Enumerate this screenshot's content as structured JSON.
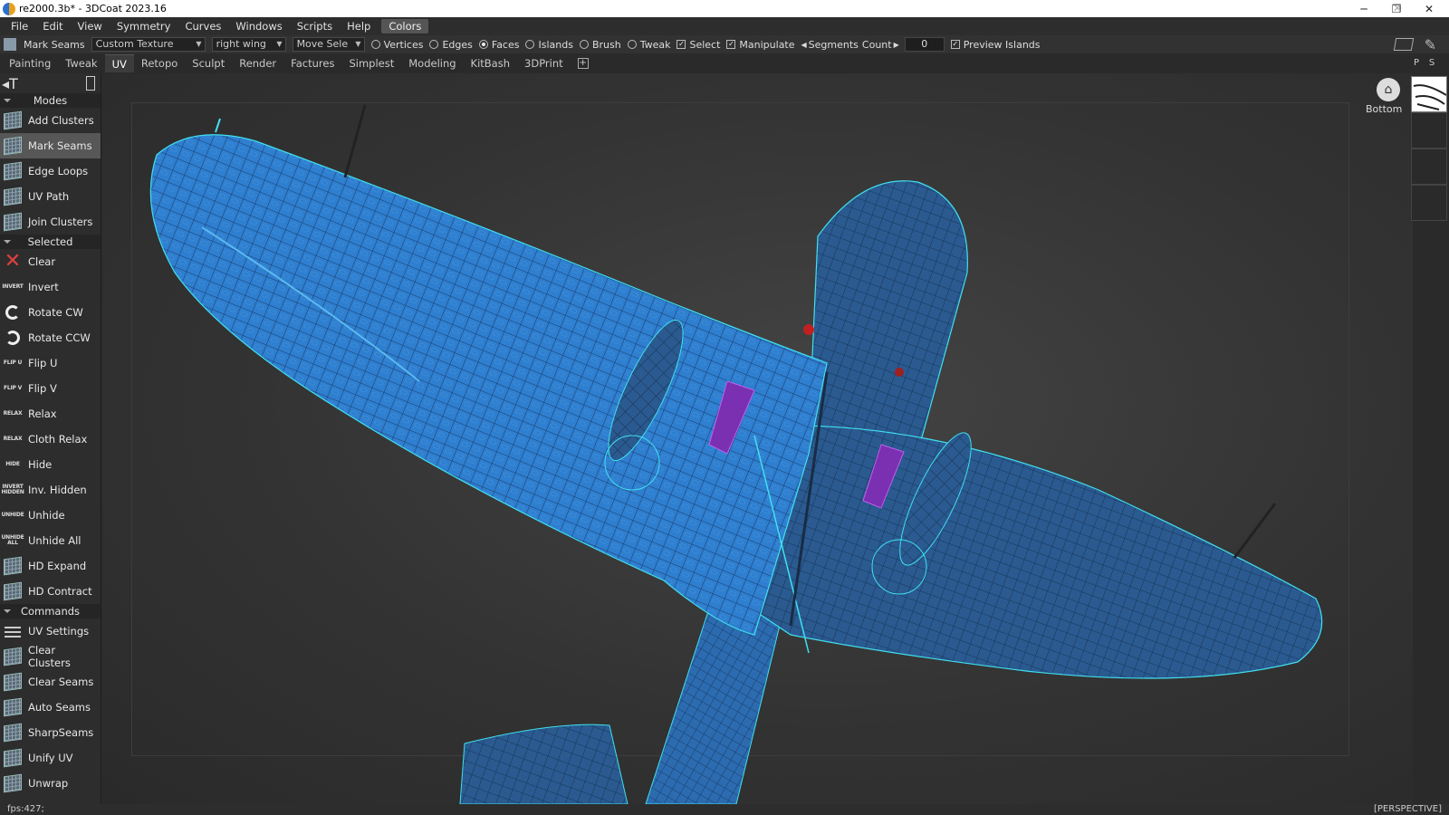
{
  "window": {
    "title": "re2000.3b* - 3DCoat 2023.16",
    "minimize": "─",
    "maximize": "❐",
    "close": "✕"
  },
  "menu": [
    "File",
    "Edit",
    "View",
    "Symmetry",
    "Curves",
    "Windows",
    "Scripts",
    "Help",
    "Colors"
  ],
  "toolbar": {
    "mode_label": "Mark Seams",
    "texture_dropdown": "Custom Texture",
    "object_dropdown": "right wing",
    "move_dropdown": "Move Sele",
    "radios": [
      {
        "label": "Vertices",
        "on": false
      },
      {
        "label": "Edges",
        "on": false
      },
      {
        "label": "Faces",
        "on": true
      },
      {
        "label": "Islands",
        "on": false
      },
      {
        "label": "Brush",
        "on": false
      },
      {
        "label": "Tweak",
        "on": false
      }
    ],
    "select_label": "Select",
    "manipulate_label": "Manipulate",
    "segments_label": "Segments",
    "count_label": "Count",
    "count_value": "0",
    "preview_label": "Preview Islands"
  },
  "tabs": [
    "Painting",
    "Tweak",
    "UV",
    "Retopo",
    "Sculpt",
    "Render",
    "Factures",
    "Simplest",
    "Modeling",
    "KitBash",
    "3DPrint"
  ],
  "active_tab": "UV",
  "right_tabs": [
    "P",
    "S"
  ],
  "panel": {
    "modes_title": "Modes",
    "modes": [
      "Add Clusters",
      "Mark Seams",
      "Edge Loops",
      "UV Path",
      "Join Clusters"
    ],
    "selected_title": "Selected",
    "selected": [
      {
        "label": "Clear",
        "icon": "clear-icon"
      },
      {
        "label": "Invert",
        "icon": "invert-icon",
        "tag": "INVERT"
      },
      {
        "label": "Rotate CW",
        "icon": "rotate-cw-icon"
      },
      {
        "label": "Rotate CCW",
        "icon": "rotate-ccw-icon"
      },
      {
        "label": "Flip U",
        "icon": "flip-u-icon",
        "tag": "FLIP U"
      },
      {
        "label": "Flip V",
        "icon": "flip-v-icon",
        "tag": "FLIP V"
      },
      {
        "label": "Relax",
        "icon": "relax-icon",
        "tag": "RELAX"
      },
      {
        "label": "Cloth Relax",
        "icon": "cloth-relax-icon",
        "tag": "RELAX"
      },
      {
        "label": "Hide",
        "icon": "hide-icon",
        "tag": "HIDE"
      },
      {
        "label": "Inv. Hidden",
        "icon": "inv-hidden-icon",
        "tag": "INVERT HIDDEN"
      },
      {
        "label": "Unhide",
        "icon": "unhide-icon",
        "tag": "UNHIDE"
      },
      {
        "label": "Unhide All",
        "icon": "unhide-all-icon",
        "tag": "UNHIDE ALL"
      },
      {
        "label": "HD Expand",
        "icon": "hd-expand-icon"
      },
      {
        "label": "HD Contract",
        "icon": "hd-contract-icon"
      }
    ],
    "commands_title": "Commands",
    "commands": [
      "UV Settings",
      "Clear Clusters",
      "Clear Seams",
      "Auto Seams",
      "SharpSeams",
      "Unify UV",
      "Unwrap"
    ]
  },
  "viewport": {
    "view_label": "Bottom"
  },
  "status": {
    "fps": "fps:427;",
    "projection": "[PERSPECTIVE]"
  },
  "colors": {
    "mesh_blue": "#2f7fd0",
    "wire": "#1a3a66",
    "seam": "#40e0f0",
    "selected": "#b040d0"
  }
}
